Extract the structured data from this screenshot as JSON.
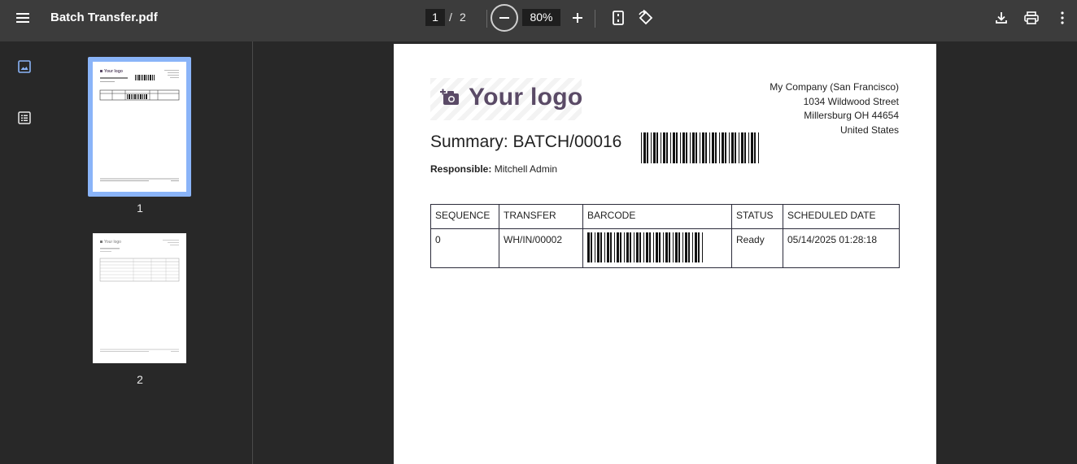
{
  "toolbar": {
    "title": "Batch Transfer.pdf",
    "current_page": "1",
    "page_separator": "/",
    "total_pages": "2",
    "zoom": "80%",
    "icons": [
      "menu-icon",
      "zoom-out-icon",
      "zoom-in-icon",
      "fit-page-icon",
      "rotate-icon",
      "download-icon",
      "print-icon",
      "more-icon"
    ]
  },
  "sidebar": {
    "icons": [
      "thumbnail-view-icon",
      "outline-view-icon"
    ],
    "thumbnails": [
      {
        "number": "1",
        "logo": "Your logo",
        "selected": true
      },
      {
        "number": "2",
        "logo": "Your logo",
        "selected": false
      }
    ],
    "selected_color": "#8ab4f8"
  },
  "document": {
    "logo_text": "Your logo",
    "logo_color": "#5a4a66",
    "company": {
      "name": "My Company (San Francisco)",
      "street": "1034 Wildwood Street",
      "city": "Millersburg OH 44654",
      "country": "United States"
    },
    "summary_title": "Summary: BATCH/00016",
    "responsible_label": "Responsible:",
    "responsible_value": "Mitchell Admin",
    "table": {
      "headers": [
        "SEQUENCE",
        "TRANSFER",
        "BARCODE",
        "STATUS",
        "SCHEDULED DATE"
      ],
      "rows": [
        {
          "sequence": "0",
          "transfer": "WH/IN/00002",
          "status": "Ready",
          "scheduled_date": "05/14/2025 01:28:18"
        }
      ]
    }
  }
}
